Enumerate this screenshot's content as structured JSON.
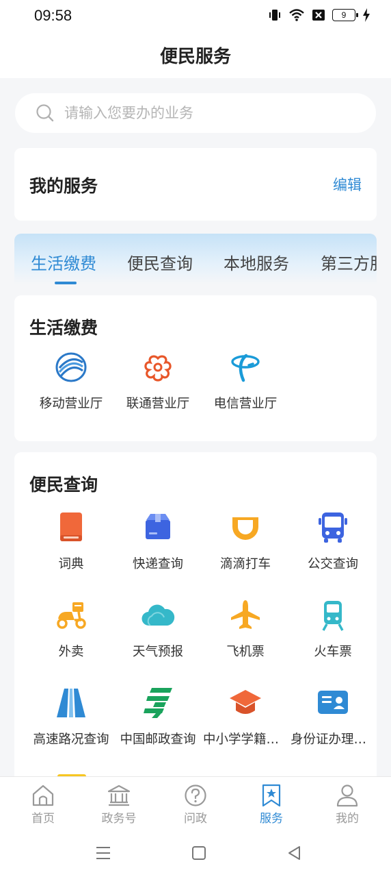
{
  "status": {
    "time": "09:58",
    "battery": "9"
  },
  "page": {
    "title": "便民服务"
  },
  "search": {
    "placeholder": "请输入您要办的业务"
  },
  "my_services": {
    "title": "我的服务",
    "edit_label": "编辑"
  },
  "tabs": [
    {
      "label": "生活缴费",
      "active": true
    },
    {
      "label": "便民查询"
    },
    {
      "label": "本地服务"
    },
    {
      "label": "第三方服务"
    }
  ],
  "life_payment": {
    "title": "生活缴费",
    "items": [
      {
        "label": "移动营业厅",
        "icon": "china-mobile-icon"
      },
      {
        "label": "联通营业厅",
        "icon": "china-unicom-icon"
      },
      {
        "label": "电信营业厅",
        "icon": "china-telecom-icon"
      }
    ]
  },
  "convenience_query": {
    "title": "便民查询",
    "items": [
      {
        "label": "词典",
        "icon": "dictionary-icon"
      },
      {
        "label": "快递查询",
        "icon": "package-icon"
      },
      {
        "label": "滴滴打车",
        "icon": "didi-icon"
      },
      {
        "label": "公交查询",
        "icon": "bus-icon"
      },
      {
        "label": "外卖",
        "icon": "scooter-icon"
      },
      {
        "label": "天气预报",
        "icon": "cloud-icon"
      },
      {
        "label": "飞机票",
        "icon": "airplane-icon"
      },
      {
        "label": "火车票",
        "icon": "train-icon"
      },
      {
        "label": "高速路况查询",
        "icon": "highway-icon"
      },
      {
        "label": "中国邮政查询",
        "icon": "china-post-icon"
      },
      {
        "label": "中小学学籍查询",
        "icon": "graduation-cap-icon"
      },
      {
        "label": "身份证办理进度",
        "icon": "id-card-icon"
      }
    ]
  },
  "tabbar": [
    {
      "label": "首页",
      "icon": "home-icon"
    },
    {
      "label": "政务号",
      "icon": "government-icon"
    },
    {
      "label": "问政",
      "icon": "question-icon"
    },
    {
      "label": "服务",
      "icon": "service-bookmark-icon",
      "active": true
    },
    {
      "label": "我的",
      "icon": "user-icon"
    }
  ],
  "colors": {
    "accent": "#2f8ad4",
    "background": "#f5f6f8"
  }
}
